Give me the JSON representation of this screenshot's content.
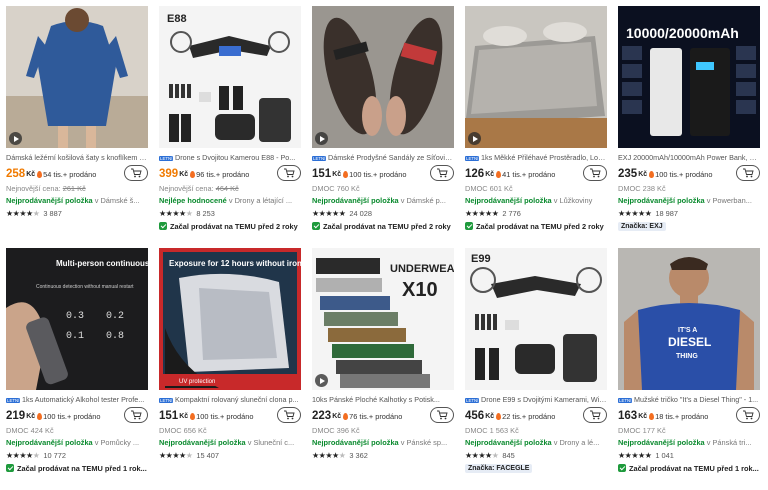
{
  "cards": [
    {
      "title": "Dámská ležérní košilová šaty s knoflíkem - ...",
      "tag": "",
      "price": "258",
      "currency": "Kč",
      "sold": "54 tis.+ prodáno",
      "line1": "Nejnovější cena: 261 Kč",
      "line1_prefix": "Nejnovější cena: ",
      "line1_strike": "261 Kč",
      "line2_green": "Nejprodávanější položka",
      "line2_rest": " v Dámské š...",
      "rating": "3 887",
      "badge": "",
      "brand": ""
    },
    {
      "title": "Drone s Dvojitou Kamerou E88 - Po...",
      "tag": "LETNÍ VÝBĚR",
      "price": "399",
      "currency": "Kč",
      "sold": "96 tis.+ prodáno",
      "line1": "Nejnovější cena: 464 Kč",
      "line1_prefix": "Nejnovější cena: ",
      "line1_strike": "464 Kč",
      "line2_green": "Nejlépe hodnocené",
      "line2_rest": " v Drony a létající ...",
      "rating": "8 253",
      "badge": "Začal prodávat na TEMU před 2 roky",
      "brand": ""
    },
    {
      "title": "Dámské Prodyšné Sandály ze Síťovin...",
      "tag": "LETNÍ VÝBĚR",
      "price": "151",
      "currency": "Kč",
      "sold": "100 tis.+ prodáno",
      "line1": "DMOC 760 Kč",
      "line1_prefix": "",
      "line1_strike": "",
      "line2_green": "Nejprodávanější položka",
      "line2_rest": " v Dámské p...",
      "rating": "24 028",
      "badge": "Začal prodávat na TEMU před 2 roky",
      "brand": ""
    },
    {
      "title": "1ks Měkké Přiléhavé Prostěradlo, Lož...",
      "tag": "LETNÍ VÝBĚR",
      "price": "126",
      "currency": "Kč",
      "sold": "41 tis.+ prodáno",
      "line1": "DMOC 601 Kč",
      "line1_prefix": "",
      "line1_strike": "",
      "line2_green": "Nejprodávanější položka",
      "line2_rest": " v Lůžkoviny",
      "rating": "2 776",
      "badge": "Začal prodávat na TEMU před 2 roky",
      "brand": ""
    },
    {
      "title": "EXJ 20000mAh/10000mAh Power Bank, 22...",
      "tag": "",
      "price": "235",
      "currency": "Kč",
      "sold": "100 tis.+ prodáno",
      "line1": "DMOC 238 Kč",
      "line1_prefix": "",
      "line1_strike": "",
      "line2_green": "Nejprodávanější položka",
      "line2_rest": " v Powerban...",
      "rating": "18 987",
      "badge": "",
      "brand": "Značka: EXJ"
    },
    {
      "title": "1ks Automatický Alkohol tester Profe...",
      "tag": "LETNÍ VÝBĚR",
      "price": "219",
      "currency": "Kč",
      "sold": "100 tis.+ prodáno",
      "line1": "DMOC 424 Kč",
      "line1_prefix": "",
      "line1_strike": "",
      "line2_green": "Nejprodávanější položka",
      "line2_rest": " v Pomůcky ...",
      "rating": "10 772",
      "badge": "Začal prodávat na TEMU před 1 rok...",
      "brand": ""
    },
    {
      "title": "Kompaktní rolovaný sluneční clona p...",
      "tag": "LETNÍ VÝBĚR",
      "price": "151",
      "currency": "Kč",
      "sold": "100 tis.+ prodáno",
      "line1": "DMOC 656 Kč",
      "line1_prefix": "",
      "line1_strike": "",
      "line2_green": "Nejprodávanější položka",
      "line2_rest": " v Sluneční c...",
      "rating": "15 407",
      "badge": "",
      "brand": ""
    },
    {
      "title": "10ks Pánské Ploché Kalhotky s Potisk...",
      "tag": "",
      "price": "223",
      "currency": "Kč",
      "sold": "76 tis.+ prodáno",
      "line1": "DMOC 396 Kč",
      "line1_prefix": "",
      "line1_strike": "",
      "line2_green": "Nejprodávanější položka",
      "line2_rest": " v Pánské sp...",
      "rating": "3 362",
      "badge": "",
      "brand": ""
    },
    {
      "title": "Drone E99 s Dvojitými Kamerami, Wi-...",
      "tag": "LETNÍ VÝBĚR",
      "price": "456",
      "currency": "Kč",
      "sold": "22 tis.+ prodáno",
      "line1": "DMOC 1 563 Kč",
      "line1_prefix": "",
      "line1_strike": "",
      "line2_green": "Nejprodávanější položka",
      "line2_rest": " v Drony a lé...",
      "rating": "845",
      "badge": "",
      "brand": "Značka: FACEGLE"
    },
    {
      "title": "Mužské tričko \"It's a Diesel Thing\" - 1...",
      "tag": "LETNÍ VÝBĚR",
      "price": "163",
      "currency": "Kč",
      "sold": "18 tis.+ prodáno",
      "line1": "DMOC 177 Kč",
      "line1_prefix": "",
      "line1_strike": "",
      "line2_green": "Nejprodávanější položka",
      "line2_rest": " v Pánská tri...",
      "rating": "1 041",
      "badge": "Začal prodávat na TEMU před 1 rok...",
      "brand": ""
    }
  ],
  "thumb_texts": {
    "e88": "E88",
    "power": "10000/20000mAh",
    "alco": "Multi-person continuous testing, fast and stable",
    "alco_sub": "Continuous detection without manual restart",
    "sun": "Exposure for 12 hours without ironing",
    "sun_sub": "UV protection",
    "under": "UNDERWEAR",
    "under_x": "X10",
    "e99": "E99",
    "shirt1": "IT'S A",
    "shirt2": "DIESEL",
    "shirt3": "THING"
  },
  "colors": {
    "price_orange": "#f07a00",
    "green": "#0a8a2e",
    "star": "#222222",
    "tag_blue": "#2c6fd6"
  }
}
